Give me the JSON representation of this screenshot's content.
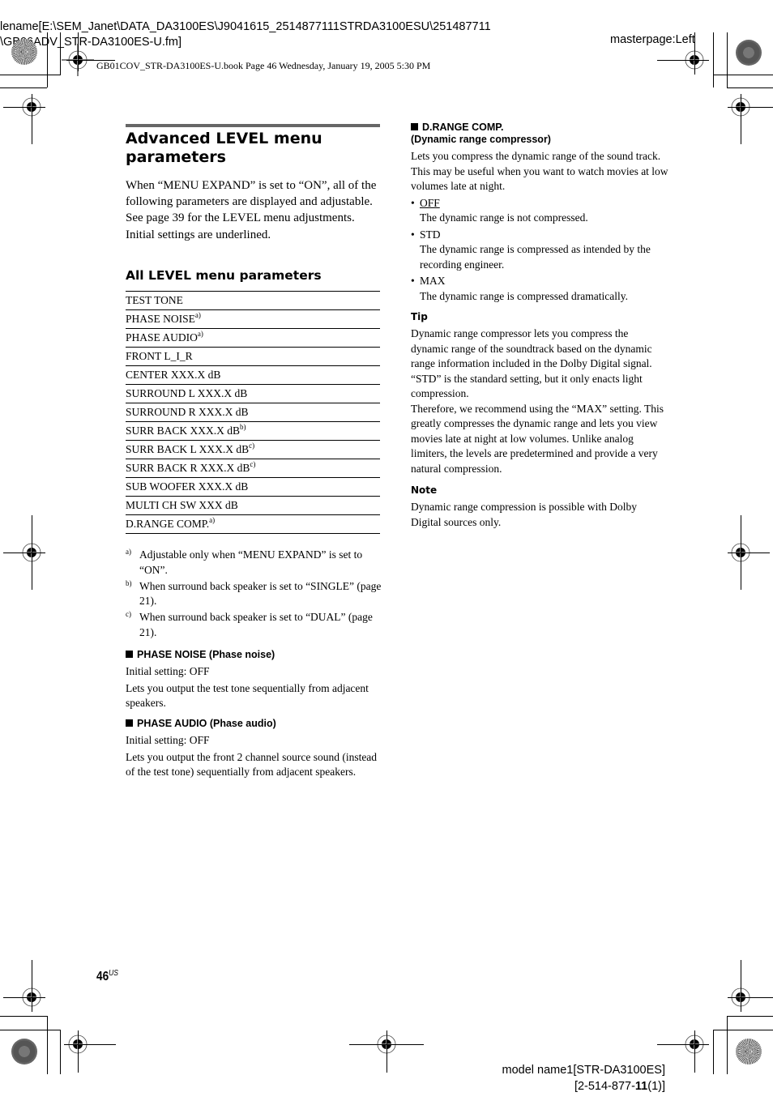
{
  "slug": {
    "file_line1": "lename[E:\\SEM_Janet\\DATA_DA3100ES\\J9041615_2514877111STRDA3100ESU\\251487711",
    "file_line2": "\\GB06ADV_STR-DA3100ES-U.fm]",
    "masterpage": "masterpage:Left",
    "book_info": "GB01COV_STR-DA3100ES-U.book  Page 46  Wednesday, January 19, 2005  5:30 PM"
  },
  "left": {
    "title": "Advanced LEVEL menu parameters",
    "intro": [
      "When “MENU EXPAND” is set to “ON”, all of the following parameters are displayed and adjustable.",
      "See page 39 for the LEVEL menu adjustments.",
      "Initial settings are underlined."
    ],
    "table_title": "All LEVEL menu parameters",
    "parameters": [
      {
        "label": "TEST TONE",
        "note": ""
      },
      {
        "label": "PHASE NOISE",
        "note": "a)"
      },
      {
        "label": "PHASE AUDIO",
        "note": "a)"
      },
      {
        "label": "FRONT L_I_R",
        "note": ""
      },
      {
        "label": "CENTER XXX.X dB",
        "note": ""
      },
      {
        "label": "SURROUND L XXX.X dB",
        "note": ""
      },
      {
        "label": "SURROUND R XXX.X dB",
        "note": ""
      },
      {
        "label": "SURR BACK XXX.X dB",
        "note": "b)"
      },
      {
        "label": "SURR BACK L XXX.X dB",
        "note": "c)"
      },
      {
        "label": "SURR BACK R XXX.X dB",
        "note": "c)"
      },
      {
        "label": "SUB WOOFER XXX.X dB",
        "note": ""
      },
      {
        "label": "MULTI CH SW XXX dB",
        "note": ""
      },
      {
        "label": "D.RANGE COMP.",
        "note": "a)"
      }
    ],
    "footnotes": [
      {
        "mark": "a)",
        "text": "Adjustable only when “MENU EXPAND” is set to “ON”."
      },
      {
        "mark": "b)",
        "text": "When surround back speaker is set to “SINGLE” (page 21)."
      },
      {
        "mark": "c)",
        "text": "When surround back speaker is set to “DUAL” (page 21)."
      }
    ],
    "phase_noise": {
      "heading": "PHASE NOISE (Phase noise)",
      "initial": "Initial setting: OFF",
      "desc": "Lets you output the test tone sequentially from adjacent speakers."
    },
    "phase_audio": {
      "heading": "PHASE AUDIO (Phase audio)",
      "initial": "Initial setting: OFF",
      "desc": "Lets you output the front 2 channel source sound (instead of the test tone) sequentially from adjacent speakers."
    }
  },
  "right": {
    "drange": {
      "heading_line1": "D.RANGE COMP.",
      "heading_line2": "(Dynamic range compressor)",
      "desc": "Lets you compress the dynamic range of the sound track. This may be useful when you want to watch movies at low volumes late at night.",
      "options": [
        {
          "label": "OFF",
          "underlined": true,
          "desc": "The dynamic range is not compressed."
        },
        {
          "label": "STD",
          "underlined": false,
          "desc": "The dynamic range is compressed as intended by the recording engineer."
        },
        {
          "label": "MAX",
          "underlined": false,
          "desc": "The dynamic range is compressed dramatically."
        }
      ]
    },
    "tip": {
      "heading": "Tip",
      "para1": "Dynamic range compressor lets you compress the dynamic range of the soundtrack based on the dynamic range information included in the Dolby Digital signal. “STD” is the standard setting, but it only enacts light compression.",
      "para2": "Therefore, we recommend using the “MAX” setting. This greatly compresses the dynamic range and lets you view movies late at night at low volumes. Unlike analog limiters, the levels are predetermined and provide a very natural compression."
    },
    "note": {
      "heading": "Note",
      "text": "Dynamic range compression is possible with Dolby Digital sources only."
    }
  },
  "footer": {
    "page_number": "46",
    "page_suffix": "US",
    "model_line1": "model name1[STR-DA3100ES]",
    "model_line2_prefix": "[2-514-877-",
    "model_line2_bold": "11",
    "model_line2_suffix": "(1)]"
  }
}
